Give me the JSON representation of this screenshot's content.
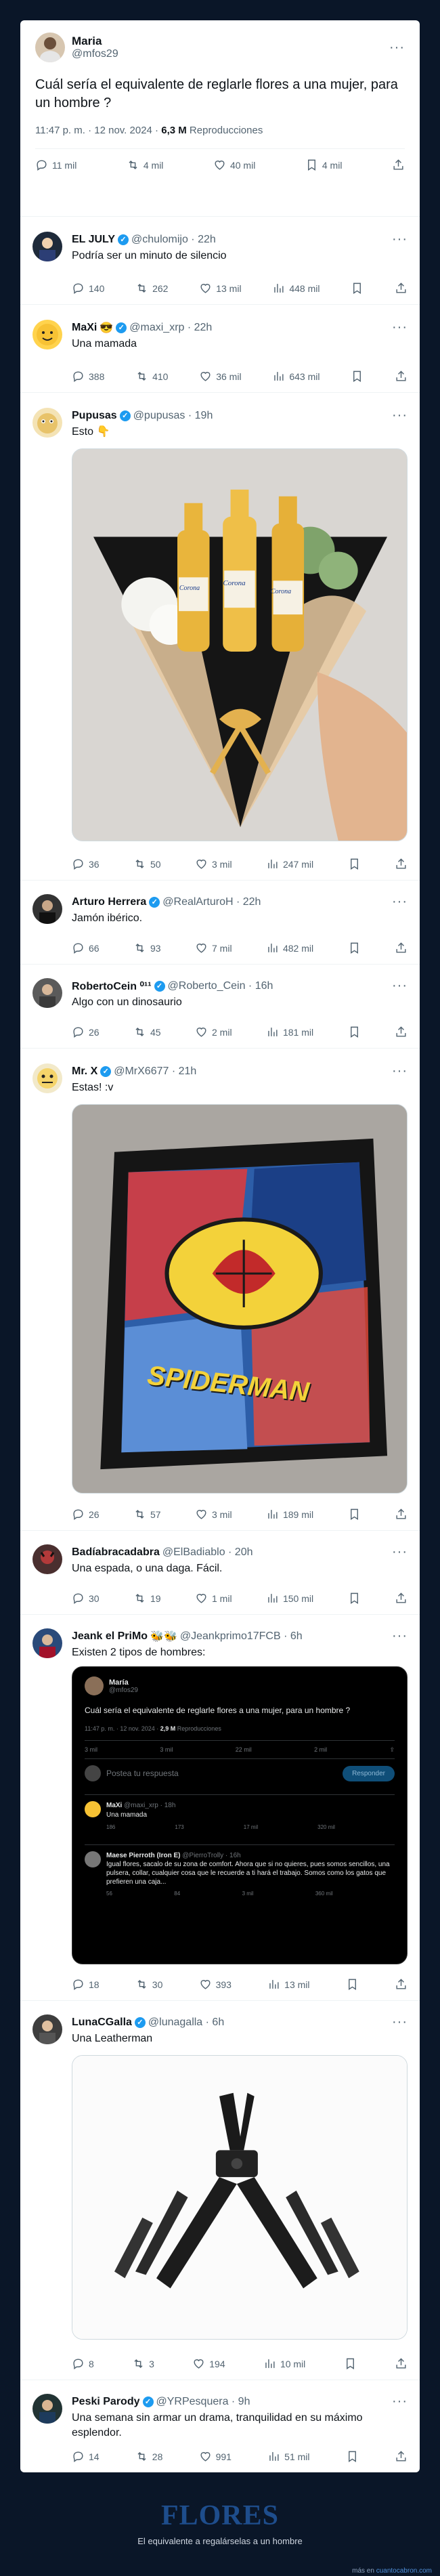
{
  "main_post": {
    "author": "Maria",
    "handle": "@mfos29",
    "text": "Cuál sería el equivalente de reglarle flores a una mujer, para un hombre ?",
    "time": "11:47 p. m. · 12 nov. 2024 ·",
    "views": "6,3 M",
    "views_label": "Reproducciones",
    "replies": "11 mil",
    "reposts": "4 mil",
    "likes": "40 mil",
    "bookmarks": "4 mil"
  },
  "replies": [
    {
      "name": "EL JULY",
      "handle": "@chulomijo · 22h",
      "text": "Podría ser un minuto de silencio",
      "replies": "140",
      "reposts": "262",
      "likes": "13 mil",
      "views": "448 mil"
    },
    {
      "name": "MaXi",
      "handle": "@maxi_xrp · 22h",
      "text": "Una mamada",
      "replies": "388",
      "reposts": "410",
      "likes": "36 mil",
      "views": "643 mil"
    },
    {
      "name": "Pupusas",
      "handle": "@pupusas · 19h",
      "text": "Esto 👇",
      "replies": "36",
      "reposts": "50",
      "likes": "3 mil",
      "views": "247 mil"
    },
    {
      "name": "Arturo Herrera",
      "handle": "@RealArturoH · 22h",
      "text": "Jamón ibérico.",
      "replies": "66",
      "reposts": "93",
      "likes": "7 mil",
      "views": "482 mil"
    },
    {
      "name": "RobertoCein ⁰¹¹",
      "handle": "@Roberto_Cein · 16h",
      "text": "Algo con un dinosaurio",
      "replies": "26",
      "reposts": "45",
      "likes": "2 mil",
      "views": "181 mil"
    },
    {
      "name": "Mr. X",
      "handle": "@MrX6677 · 21h",
      "text": "Estas! :v",
      "replies": "26",
      "reposts": "57",
      "likes": "3 mil",
      "views": "189 mil"
    },
    {
      "name": "Badíabracadabra",
      "handle": "@ElBadiablo · 20h",
      "text": "Una espada, o una daga. Fácil.",
      "replies": "30",
      "reposts": "19",
      "likes": "1 mil",
      "views": "150 mil"
    },
    {
      "name": "Jeank el PriMo",
      "handle": "@Jeankprimo17FCB · 6h",
      "text": "Existen 2 tipos de hombres:",
      "replies": "18",
      "reposts": "30",
      "likes": "393",
      "views": "13 mil"
    },
    {
      "name": "LunaCGalla",
      "handle": "@lunagalla · 6h",
      "text": "Una Leatherman",
      "replies": "8",
      "reposts": "3",
      "likes": "194",
      "views": "10 mil"
    },
    {
      "name": "Peski Parody",
      "handle": "@YRPesquera · 9h",
      "text": "Una semana sin armar un drama, tranquilidad en su máximo esplendor.",
      "replies": "14",
      "reposts": "28",
      "likes": "991",
      "views": "51 mil"
    }
  ],
  "embedded": {
    "author": "María",
    "handle": "@mfos29",
    "text": "Cuál sería el equivalente de reglarle flores a una mujer, para un hombre ?",
    "meta": "11:47 p. m. · 12 nov. 2024 ·",
    "views": "2,9 M",
    "views_label": "Reproducciones",
    "stats": [
      "3 mil",
      "3 mil",
      "22 mil",
      "2 mil"
    ],
    "compose_placeholder": "Postea tu respuesta",
    "compose_button": "Responder",
    "r1_name": "MaXi",
    "r1_handle": "@maxi_xrp · 18h",
    "r1_text": "Una mamada",
    "r1_stats": [
      "186",
      "173",
      "17 mil",
      "320 mil"
    ],
    "r2_name": "Maese Pierroth (Iron E)",
    "r2_handle": "@PierroTrolly · 16h",
    "r2_text": "Igual flores, sacalo de su zona de comfort. Ahora que si no quieres, pues somos sencillos, una pulsera, collar, cualquier cosa que le recuerde a ti hará el trabajo. Somos como los gatos que prefieren una caja...",
    "r2_stats": [
      "56",
      "84",
      "3 mil",
      "360 mil"
    ]
  },
  "image_labels": {
    "beer": "Corona",
    "wallet": "SPIDERMAN"
  },
  "footer": {
    "title": "FLORES",
    "subtitle": "El equivalente a regalárselas a un hombre",
    "source_prefix": "más en",
    "source_site": "cuantocabron.com"
  },
  "colors": {
    "accent": "#1d9bf0",
    "footer_bg": "#0a1628",
    "footer_title": "#1e4d8c"
  }
}
